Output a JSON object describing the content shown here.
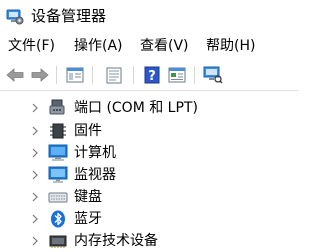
{
  "window": {
    "title": "设备管理器",
    "icon": "device-manager-icon"
  },
  "menu": [
    {
      "label": "文件(F)"
    },
    {
      "label": "操作(A)"
    },
    {
      "label": "查看(V)"
    },
    {
      "label": "帮助(H)"
    }
  ],
  "toolbar": {
    "buttons": [
      "back-arrow-icon",
      "forward-arrow-icon",
      "show-hide-tree-icon",
      "properties-icon",
      "help-icon",
      "update-driver-icon",
      "scan-hardware-icon"
    ]
  },
  "tree": {
    "items": [
      {
        "label": "端口 (COM 和 LPT)",
        "icon": "port-icon"
      },
      {
        "label": "固件",
        "icon": "firmware-chip-icon"
      },
      {
        "label": "计算机",
        "icon": "computer-icon"
      },
      {
        "label": "监视器",
        "icon": "monitor-icon"
      },
      {
        "label": "键盘",
        "icon": "keyboard-icon"
      },
      {
        "label": "蓝牙",
        "icon": "bluetooth-icon"
      },
      {
        "label": "内存技术设备",
        "icon": "memory-device-icon"
      }
    ]
  },
  "colors": {
    "accent": "#1e7bd6",
    "chevron": "#7a7a7a",
    "bluetooth": "#1a6fd9",
    "help_icon": "#2b57c8"
  }
}
